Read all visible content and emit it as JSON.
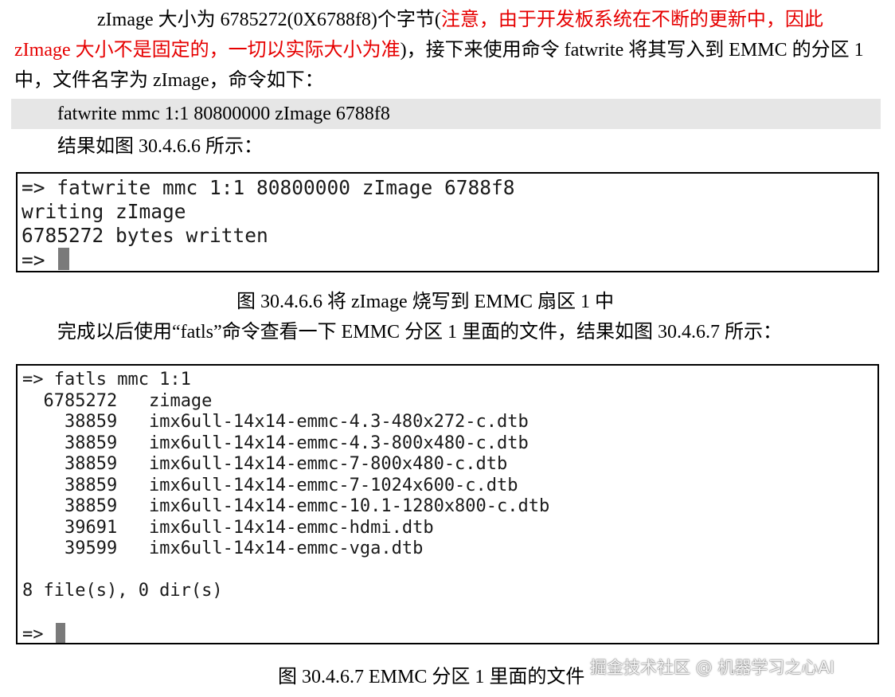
{
  "para1": {
    "text_a": "zImage 大小为 6785272(0X6788f8)个字节(",
    "red_text": "注意，由于开发板系统在不断的更新中，因此zImage 大小不是固定的，一切以实际大小为准",
    "text_b": ")，接下来使用命令 fatwrite 将其写入到 EMMC 的分区 1 中，文件名字为 zImage，命令如下："
  },
  "command": "fatwrite mmc 1:1 80800000 zImage 6788f8",
  "result_intro": "结果如图 30.4.6.6 所示：",
  "terminal1": {
    "lines": [
      "=> fatwrite mmc 1:1 80800000 zImage 6788f8",
      "writing zImage",
      "6785272 bytes written"
    ],
    "prompt": "=> "
  },
  "caption1": "图 30.4.6.6  将 zImage 烧写到 EMMC 扇区 1 中",
  "para2": "完成以后使用“fatls”命令查看一下 EMMC 分区 1 里面的文件，结果如图 30.4.6.7 所示：",
  "terminal2": {
    "command": "=> fatls mmc 1:1",
    "files": [
      {
        "size": "6785272",
        "name": "zimage"
      },
      {
        "size": "38859",
        "name": "imx6ull-14x14-emmc-4.3-480x272-c.dtb"
      },
      {
        "size": "38859",
        "name": "imx6ull-14x14-emmc-4.3-800x480-c.dtb"
      },
      {
        "size": "38859",
        "name": "imx6ull-14x14-emmc-7-800x480-c.dtb"
      },
      {
        "size": "38859",
        "name": "imx6ull-14x14-emmc-7-1024x600-c.dtb"
      },
      {
        "size": "38859",
        "name": "imx6ull-14x14-emmc-10.1-1280x800-c.dtb"
      },
      {
        "size": "39691",
        "name": "imx6ull-14x14-emmc-hdmi.dtb"
      },
      {
        "size": "39599",
        "name": "imx6ull-14x14-emmc-vga.dtb"
      }
    ],
    "summary": "8 file(s), 0 dir(s)",
    "prompt": "=> "
  },
  "caption2": "图 30.4.6.7 EMMC 分区 1 里面的文件",
  "watermark": "掘金技术社区 @ 机器学习之心AI"
}
